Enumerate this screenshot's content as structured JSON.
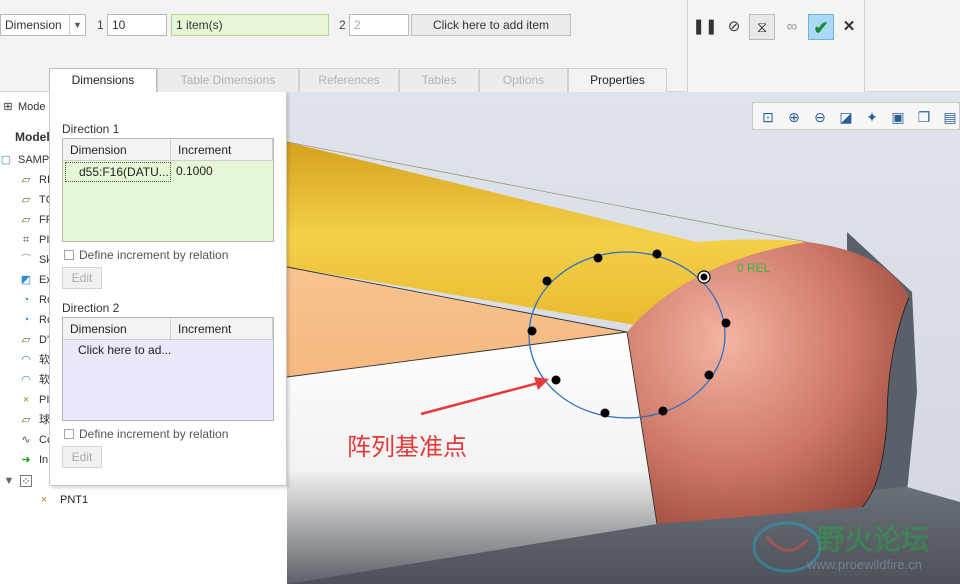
{
  "toolbar": {
    "type_value": "Dimension",
    "dir1_label": "1",
    "dir1_count": "10",
    "dir1_collector": "1 item(s)",
    "dir2_label": "2",
    "dir2_count": "2",
    "dir2_collector": "Click here to add item"
  },
  "tabs": [
    {
      "label": "Dimensions",
      "state": "active"
    },
    {
      "label": "Table Dimensions",
      "state": "disabled"
    },
    {
      "label": "References",
      "state": "disabled"
    },
    {
      "label": "Tables",
      "state": "disabled"
    },
    {
      "label": "Options",
      "state": "disabled"
    },
    {
      "label": "Properties",
      "state": "enabled"
    }
  ],
  "model_tree": {
    "header_label": "Mode",
    "title": "Model",
    "items": [
      {
        "label": "SAMP",
        "icon": "part-icon"
      },
      {
        "label": "RI",
        "icon": "datum-plane-icon"
      },
      {
        "label": "TC",
        "icon": "datum-plane-icon"
      },
      {
        "label": "FF",
        "icon": "datum-plane-icon"
      },
      {
        "label": "PI",
        "icon": "coordinate-system-icon"
      },
      {
        "label": "Sk",
        "icon": "sketch-icon"
      },
      {
        "label": "Ex",
        "icon": "extrude-icon"
      },
      {
        "label": "Rc",
        "icon": "revolve-icon"
      },
      {
        "label": "Rc",
        "icon": "revolve-icon"
      },
      {
        "label": "D'",
        "icon": "datum-plane-icon"
      },
      {
        "label": "软",
        "icon": "surface-icon"
      },
      {
        "label": "软",
        "icon": "surface-icon"
      },
      {
        "label": "PI",
        "icon": "point-icon"
      },
      {
        "label": "球",
        "icon": "datum-plane-icon"
      },
      {
        "label": "Cc",
        "icon": "curve-icon"
      },
      {
        "label": "In",
        "icon": "insert-arrow-icon"
      },
      {
        "label": "※",
        "icon": "pattern-icon"
      },
      {
        "label": "PNT1",
        "icon": "point-icon"
      }
    ]
  },
  "panel": {
    "direction1_label": "Direction 1",
    "direction1_table": {
      "headers": [
        "Dimension",
        "Increment"
      ],
      "rows": [
        [
          "d55:F16(DATU...",
          "0.1000"
        ]
      ]
    },
    "direction1_checkbox": "Define increment by relation",
    "direction1_edit": "Edit",
    "direction2_label": "Direction 2",
    "direction2_table": {
      "headers": [
        "Dimension",
        "Increment"
      ],
      "rows": [
        [
          "Click here to ad...",
          ""
        ]
      ]
    },
    "direction2_checkbox": "Define increment by relation",
    "direction2_edit": "Edit"
  },
  "viewport": {
    "ref_label": "0 REL",
    "annotation": "阵列基准点",
    "watermark_text": "野火论坛",
    "watermark_url": "www.proewildfire.cn"
  },
  "colors": {
    "collector_green": "#e7f6d5",
    "table1_green": "#e6f7d5",
    "table2_lavender": "#ece8fb",
    "ok_button_blue": "#a9d9f7",
    "annotation_red": "#e53a3a"
  }
}
